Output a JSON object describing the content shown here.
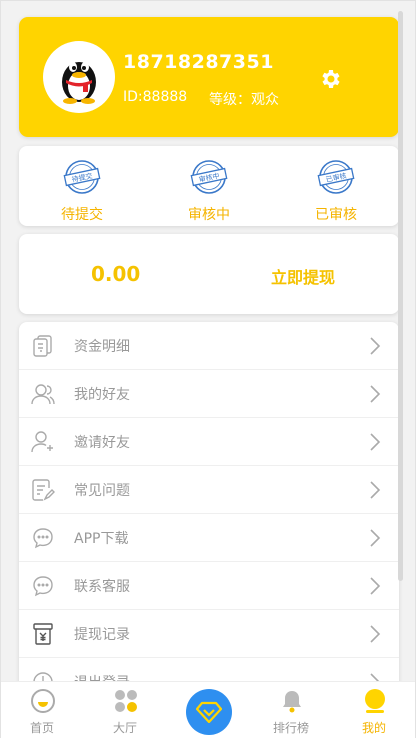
{
  "profile": {
    "phone": "18718287351",
    "uid": "ID:88888",
    "level": "等级：观众",
    "avatar_icon": "qq-penguin-icon",
    "settings_icon": "gear-icon"
  },
  "status": [
    {
      "stamp": "待提交",
      "label": "待提交"
    },
    {
      "stamp": "审核中",
      "label": "审核中"
    },
    {
      "stamp": "已审核",
      "label": "已审核"
    }
  ],
  "wallet": {
    "balance": "0.00",
    "withdraw_label": "立即提现"
  },
  "menu": [
    {
      "label": "资金明细",
      "icon": "fund-detail-icon"
    },
    {
      "label": "我的好友",
      "icon": "friends-icon"
    },
    {
      "label": "邀请好友",
      "icon": "invite-user-icon"
    },
    {
      "label": "常见问题",
      "icon": "faq-document-icon"
    },
    {
      "label": "APP下载",
      "icon": "chat-bubble-icon"
    },
    {
      "label": "联系客服",
      "icon": "chat-bubble-icon"
    },
    {
      "label": "提现记录",
      "icon": "yen-record-icon"
    },
    {
      "label": "退出登录",
      "icon": "logout-icon"
    }
  ],
  "nav": {
    "home": "首页",
    "hall": "大厅",
    "center_icon": "diamond-icon",
    "ranking": "排行榜",
    "mine": "我的"
  },
  "colors": {
    "brand_yellow": "#ffd400",
    "accent_text": "#f5c200",
    "center_button": "#2e8ff0"
  }
}
